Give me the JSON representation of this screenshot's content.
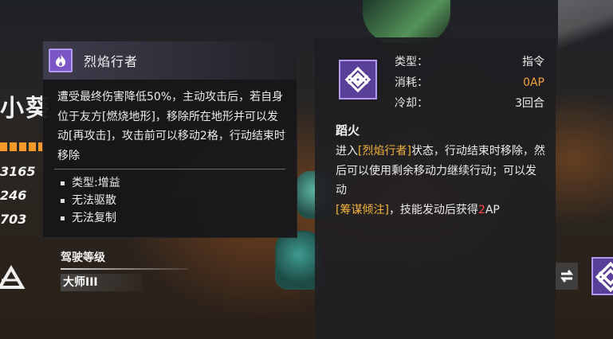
{
  "left_character": {
    "name_partial": "小葵",
    "stats": [
      "3165",
      "246",
      "703"
    ]
  },
  "pilot": {
    "rank_label": "驾驶等级",
    "rank_value": "大师III"
  },
  "status_tooltip": {
    "icon": "flame-icon",
    "title": "烈焰行者",
    "description": "遭受最终伤害降低50%，主动攻击后，若自身位于友方[燃烧地形]，移除所在地形并可以发动[再攻击]，攻击前可以移动2格，行动结束时移除",
    "tags": [
      "类型:增益",
      "无法驱散",
      "无法复制"
    ]
  },
  "skill_tooltip": {
    "icon": "knot-emblem-icon",
    "type_label": "类型：",
    "type_value": "指令",
    "cost_label": "消耗：",
    "cost_value": "0AP",
    "cooldown_label": "冷却：",
    "cooldown_value": "3回合",
    "name": "蹈火",
    "desc_part1": "进入",
    "desc_status": "[烈焰行者]",
    "desc_part2": "状态，行动结束时移除，然后可以使用剩余移动力继续行动；可以发动",
    "desc_skill": "[筹谋倾注]",
    "desc_part3": "，技能发动后获得",
    "desc_ap_num": "2",
    "desc_part4": "AP"
  },
  "colors": {
    "accent_purple": "#7c56c4",
    "highlight_yellow": "#f2b43a",
    "ap_orange": "#f2a33a",
    "highlight_red": "#ff4a4a"
  }
}
